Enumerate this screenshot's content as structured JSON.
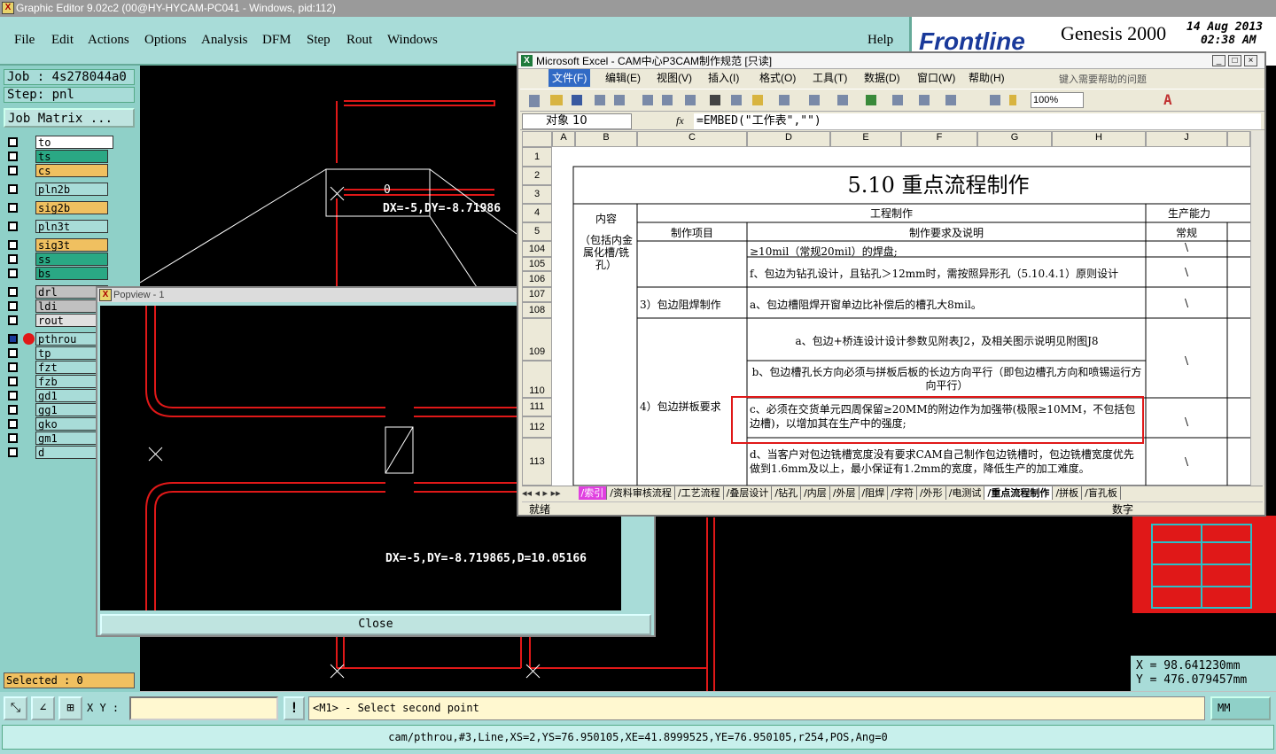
{
  "app": {
    "title": "Graphic Editor 9.02c2 (00@HY-HYCAM-PC041 - Windows, pid:112)",
    "menu": [
      "File",
      "Edit",
      "Actions",
      "Options",
      "Analysis",
      "DFM",
      "Step",
      "Rout",
      "Windows"
    ],
    "help": "Help",
    "brand": {
      "logo": "Frontline",
      "product": "Genesis 2000",
      "date": "14 Aug 2013",
      "time": "02:38 AM"
    }
  },
  "sidebar": {
    "job": "Job : 4s278044a0",
    "step": "Step: pnl",
    "job_matrix": "Job Matrix ...",
    "layers": [
      {
        "name": "to",
        "color": "#ffffff"
      },
      {
        "name": "ts",
        "color": "#2aa884"
      },
      {
        "name": "cs",
        "color": "#f0c060"
      },
      {
        "name": "pln2b",
        "color": "#a8dcd8"
      },
      {
        "name": "sig2b",
        "color": "#f0c060"
      },
      {
        "name": "pln3t",
        "color": "#a8dcd8"
      },
      {
        "name": "sig3t",
        "color": "#f0c060"
      },
      {
        "name": "ss",
        "color": "#2aa884"
      },
      {
        "name": "bs",
        "color": "#2aa884"
      },
      {
        "name": "drl",
        "color": "#c0c0c0"
      },
      {
        "name": "ldi",
        "color": "#c0c0c0"
      },
      {
        "name": "rout",
        "color": "#e0e0e0"
      },
      {
        "name": "pthrou",
        "color": "#a8dcd8"
      },
      {
        "name": "tp",
        "color": "#a8dcd8"
      },
      {
        "name": "fzt",
        "color": "#a8dcd8"
      },
      {
        "name": "fzb",
        "color": "#a8dcd8"
      },
      {
        "name": "gd1",
        "color": "#a8dcd8"
      },
      {
        "name": "gg1",
        "color": "#a8dcd8"
      },
      {
        "name": "gko",
        "color": "#a8dcd8"
      },
      {
        "name": "gm1",
        "color": "#a8dcd8"
      },
      {
        "name": "d",
        "color": "#a8dcd8"
      }
    ],
    "selected": "Selected : 0"
  },
  "canvas": {
    "measure_top": "DX=-5,DY=-8.71986",
    "cursor_zero": "0"
  },
  "popview": {
    "title": "Popview - 1",
    "measure": "DX=-5,DY=-8.719865,D=10.05166",
    "close": "Close"
  },
  "excel": {
    "title": "Microsoft Excel - CAM中心P3CAM制作规范 [只读]",
    "menu": [
      "文件(F)",
      "编辑(E)",
      "视图(V)",
      "插入(I)",
      "格式(O)",
      "工具(T)",
      "数据(D)",
      "窗口(W)",
      "帮助(H)"
    ],
    "help_placeholder": "键入需要帮助的问题",
    "zoom": "100%",
    "name_box": "对象 10",
    "fx": "fx",
    "formula": "=EMBED(\"工作表\",\"\")",
    "columns": [
      "A",
      "B",
      "C",
      "D",
      "E",
      "F",
      "G",
      "H",
      "J"
    ],
    "rows": [
      "1",
      "2",
      "3",
      "4",
      "5",
      "104",
      "105",
      "106",
      "107",
      "108",
      "109",
      "110",
      "111",
      "112",
      "113"
    ],
    "sheet_title": "5.10 重点流程制作",
    "hdr_content": "内容",
    "hdr_engineering": "工程制作",
    "hdr_capability": "生产能力",
    "hdr_item": "制作项目",
    "hdr_req": "制作要求及说明",
    "hdr_normal": "常规",
    "b_note": "（包括内金属化槽/铣孔）",
    "r104": "≥10mil（常规20mil）的焊盘;",
    "r105": "f、包边为钻孔设计，且钻孔＞12mm时，需按照异形孔（5.10.4.1）原则设计",
    "r107_item": "3）包边阻焊制作",
    "r107": "a、包边槽阻焊开窗单边比补偿后的槽孔大8mil。",
    "r109": "a、包边+桥连设计设计参数见附表J2，及相关图示说明见附图J8",
    "r110": "b、包边槽孔长方向必须与拼板后板的长边方向平行（即包边槽孔方向和喷锡运行方向平行）",
    "r111_item": "4）包边拼板要求",
    "r111": "c、必须在交货单元四周保留≥20MM的附边作为加强带(极限≥10MM，不包括包边槽)，以增加其在生产中的强度;",
    "r113": "d、当客户对包边铣槽宽度没有要求CAM自己制作包边铣槽时，包边铣槽宽度优先做到1.6mm及以上，最小保证有1.2mm的宽度，降低生产的加工难度。",
    "backslash": "\\",
    "tabs": [
      "索引",
      "资料审核流程",
      "工艺流程",
      "叠层设计",
      "钻孔",
      "内层",
      "外层",
      "阻焊",
      "字符",
      "外形",
      "电测试",
      "重点流程制作",
      "拼板",
      "盲孔板"
    ],
    "status_left": "就绪",
    "status_right": "数字"
  },
  "bottom": {
    "xy_label": "X Y :",
    "xy_value": "",
    "prompt": "<M1> - Select second point",
    "units": "MM",
    "status": "cam/pthrou,#3,Line,XS=2,YS=76.950105,XE=41.8999525,YE=76.950105,r254,POS,Ang=0",
    "x_coord": "X  =  98.641230mm",
    "y_coord": "Y  =  476.079457mm"
  }
}
